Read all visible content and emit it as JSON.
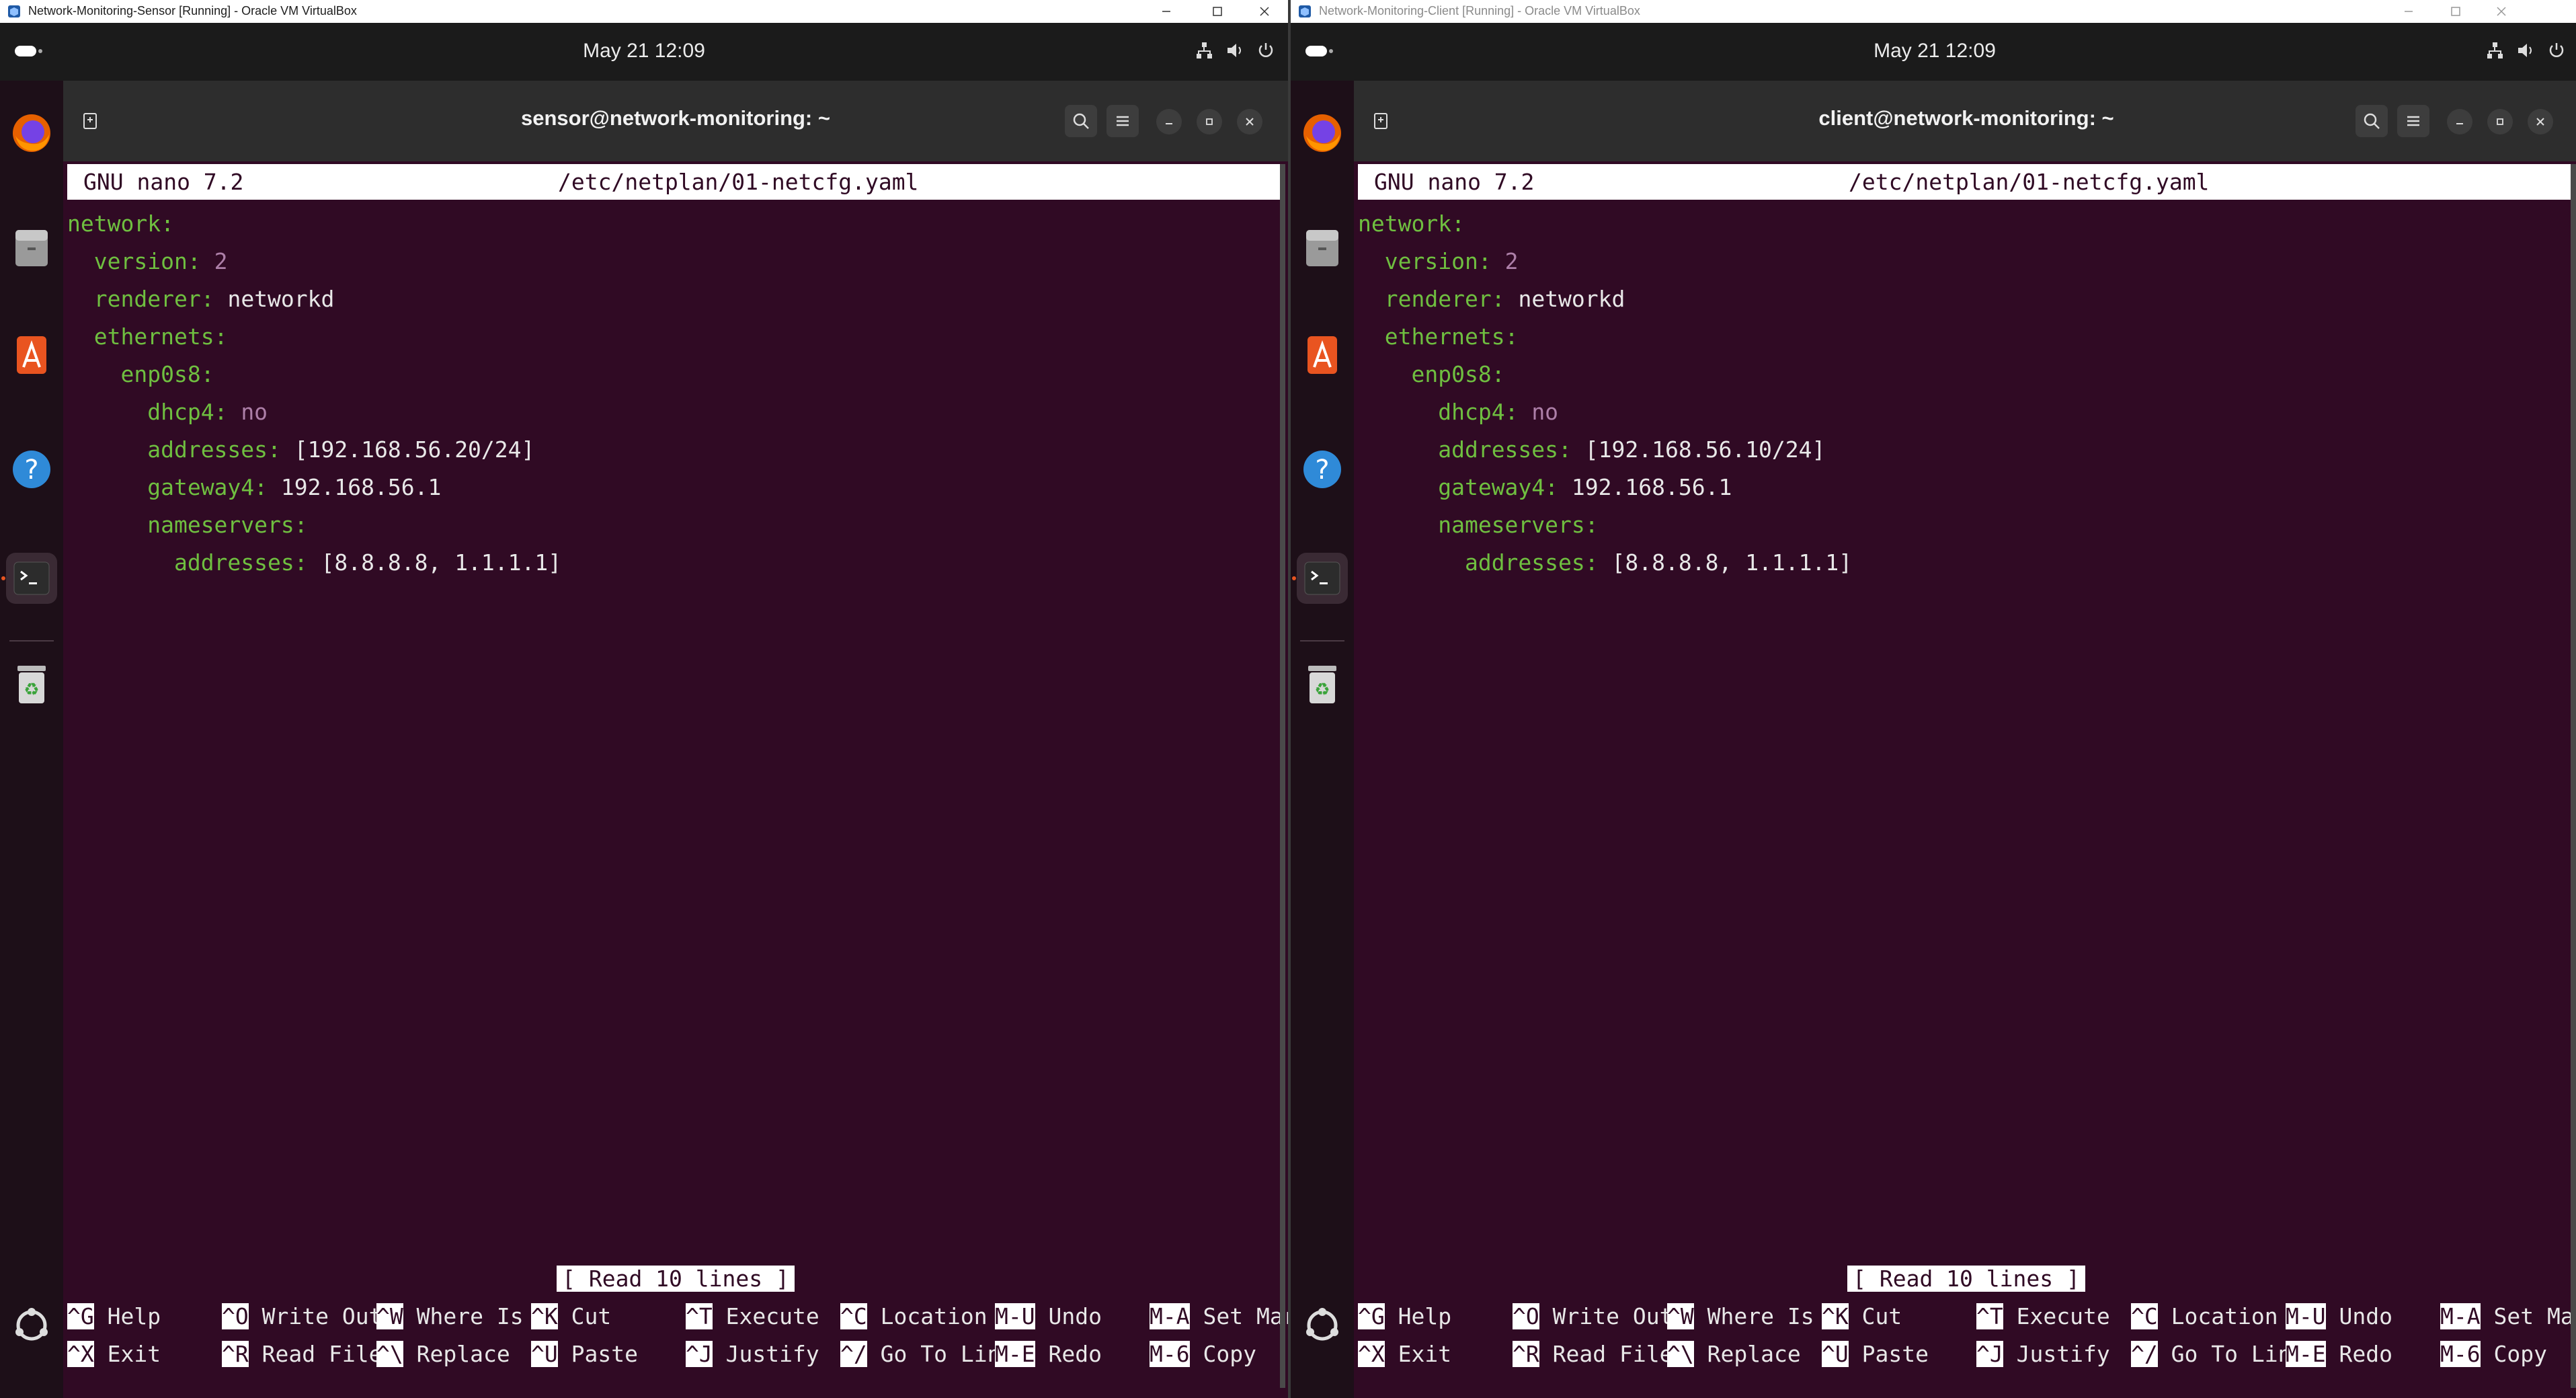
{
  "vms": {
    "left": {
      "host_title": "Network-Monitoring-Sensor [Running] - Oracle VM VirtualBox",
      "clock": "May 21  12:09",
      "terminal_title": "sensor@network-monitoring: ~",
      "nano_version": "GNU nano 7.2",
      "nano_file": "/etc/netplan/01-netcfg.yaml",
      "status": "[ Read 10 lines ]",
      "lines": [
        {
          "indent": "",
          "key": "network",
          "sep": ":",
          "value": "",
          "vclass": ""
        },
        {
          "indent": "  ",
          "key": "version",
          "sep": ": ",
          "value": "2",
          "vclass": "v-num"
        },
        {
          "indent": "  ",
          "key": "renderer",
          "sep": ": ",
          "value": "networkd",
          "vclass": "v-str"
        },
        {
          "indent": "  ",
          "key": "ethernets",
          "sep": ":",
          "value": "",
          "vclass": ""
        },
        {
          "indent": "    ",
          "key": "enp0s8",
          "sep": ":",
          "value": "",
          "vclass": ""
        },
        {
          "indent": "      ",
          "key": "dhcp4",
          "sep": ": ",
          "value": "no",
          "vclass": "v-kw"
        },
        {
          "indent": "      ",
          "key": "addresses",
          "sep": ": ",
          "value": "[192.168.56.20/24]",
          "vclass": "v-str"
        },
        {
          "indent": "      ",
          "key": "gateway4",
          "sep": ": ",
          "value": "192.168.56.1",
          "vclass": "v-str"
        },
        {
          "indent": "      ",
          "key": "nameservers",
          "sep": ":",
          "value": "",
          "vclass": ""
        },
        {
          "indent": "        ",
          "key": "addresses",
          "sep": ": ",
          "value": "[8.8.8.8, 1.1.1.1]",
          "vclass": "v-str"
        }
      ]
    },
    "right": {
      "host_title": "Network-Monitoring-Client [Running] - Oracle VM VirtualBox",
      "clock": "May 21  12:09",
      "terminal_title": "client@network-monitoring: ~",
      "nano_version": "GNU nano 7.2",
      "nano_file": "/etc/netplan/01-netcfg.yaml",
      "status": "[ Read 10 lines ]",
      "lines": [
        {
          "indent": "",
          "key": "network",
          "sep": ":",
          "value": "",
          "vclass": ""
        },
        {
          "indent": "  ",
          "key": "version",
          "sep": ": ",
          "value": "2",
          "vclass": "v-num"
        },
        {
          "indent": "  ",
          "key": "renderer",
          "sep": ": ",
          "value": "networkd",
          "vclass": "v-str"
        },
        {
          "indent": "  ",
          "key": "ethernets",
          "sep": ":",
          "value": "",
          "vclass": ""
        },
        {
          "indent": "    ",
          "key": "enp0s8",
          "sep": ":",
          "value": "",
          "vclass": ""
        },
        {
          "indent": "      ",
          "key": "dhcp4",
          "sep": ": ",
          "value": "no",
          "vclass": "v-kw"
        },
        {
          "indent": "      ",
          "key": "addresses",
          "sep": ": ",
          "value": "[192.168.56.10/24]",
          "vclass": "v-str"
        },
        {
          "indent": "      ",
          "key": "gateway4",
          "sep": ": ",
          "value": "192.168.56.1",
          "vclass": "v-str"
        },
        {
          "indent": "      ",
          "key": "nameservers",
          "sep": ":",
          "value": "",
          "vclass": ""
        },
        {
          "indent": "        ",
          "key": "addresses",
          "sep": ": ",
          "value": "[8.8.8.8, 1.1.1.1]",
          "vclass": "v-str"
        }
      ]
    }
  },
  "shortcuts": [
    [
      {
        "key": "^G",
        "label": "Help"
      },
      {
        "key": "^X",
        "label": "Exit"
      }
    ],
    [
      {
        "key": "^O",
        "label": "Write Out"
      },
      {
        "key": "^R",
        "label": "Read File"
      }
    ],
    [
      {
        "key": "^W",
        "label": "Where Is"
      },
      {
        "key": "^\\",
        "label": "Replace"
      }
    ],
    [
      {
        "key": "^K",
        "label": "Cut"
      },
      {
        "key": "^U",
        "label": "Paste"
      }
    ],
    [
      {
        "key": "^T",
        "label": "Execute"
      },
      {
        "key": "^J",
        "label": "Justify"
      }
    ],
    [
      {
        "key": "^C",
        "label": "Location"
      },
      {
        "key": "^/",
        "label": "Go To Line"
      }
    ],
    [
      {
        "key": "M-U",
        "label": "Undo"
      },
      {
        "key": "M-E",
        "label": "Redo"
      }
    ],
    [
      {
        "key": "M-A",
        "label": "Set Mark"
      },
      {
        "key": "M-6",
        "label": "Copy"
      }
    ]
  ],
  "dock": [
    "firefox-icon",
    "files-icon",
    "app-center-icon",
    "help-icon",
    "terminal-icon",
    "trash-icon"
  ],
  "colors": {
    "terminal_bg": "#300a24",
    "yaml_key": "#6fbf40",
    "yaml_number": "#ad7fa8",
    "ubuntu_orange": "#e95420"
  }
}
